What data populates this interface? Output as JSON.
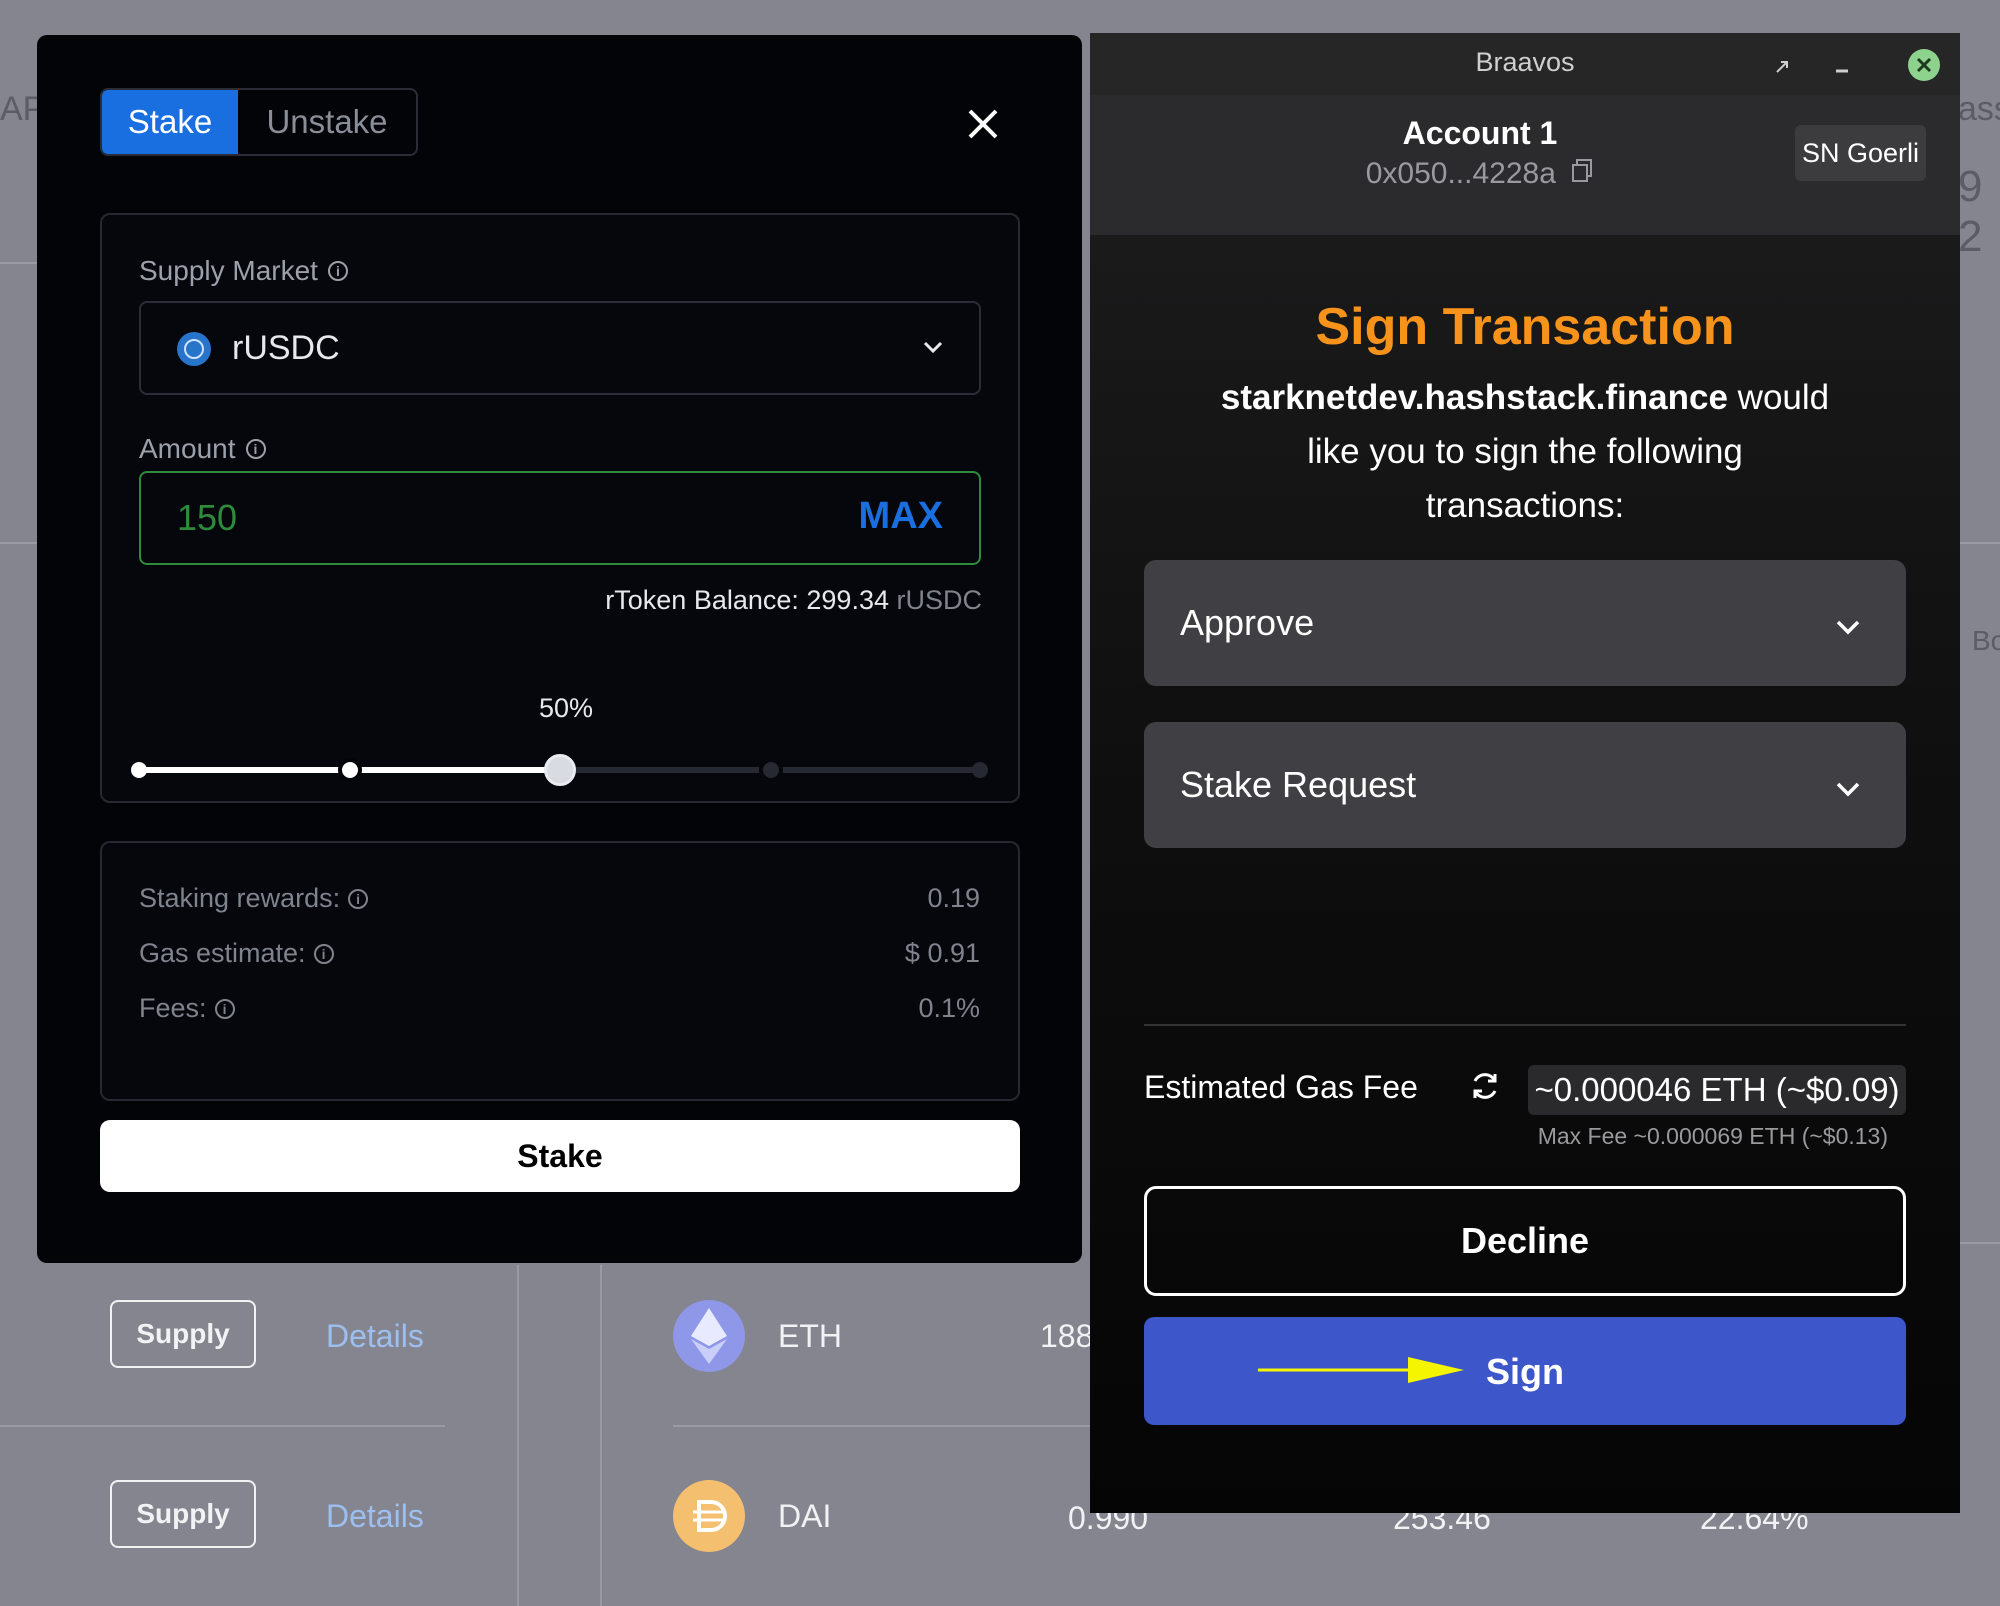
{
  "background": {
    "partial_texts": [
      "AP",
      "ass",
      "9 2",
      "Bo"
    ],
    "rows": [
      {
        "supply_label": "Supply",
        "details_label": "Details",
        "asset": "ETH",
        "price": "188"
      },
      {
        "supply_label": "Supply",
        "details_label": "Details",
        "asset": "DAI",
        "price": "0.990",
        "col2": "253.46",
        "col3": "22.64%"
      }
    ]
  },
  "stake_modal": {
    "tabs": [
      {
        "label": "Stake",
        "active": true
      },
      {
        "label": "Unstake",
        "active": false
      }
    ],
    "supply_market_label": "Supply Market",
    "market_selected": "rUSDC",
    "amount_label": "Amount",
    "amount_value": "150",
    "max_label": "MAX",
    "balance_label": "rToken Balance: 299.34",
    "balance_unit": "rUSDC",
    "slider_percent_label": "50%",
    "slider_value": 0.5,
    "details": {
      "staking_rewards_label": "Staking rewards:",
      "staking_rewards_value": "0.19",
      "gas_estimate_label": "Gas estimate:",
      "gas_estimate_value": "$ 0.91",
      "fees_label": "Fees:",
      "fees_value": "0.1%"
    },
    "stake_button": "Stake"
  },
  "braavos": {
    "window_title": "Braavos",
    "account_name": "Account 1",
    "account_address": "0x050...4228a",
    "network": "SN Goerli",
    "heading": "Sign Transaction",
    "dapp_domain": "starknetdev.hashstack.finance",
    "message_line1": "would",
    "message_line2": "like you to sign the following",
    "message_line3": "transactions:",
    "transactions": [
      "Approve",
      "Stake Request"
    ],
    "gas_fee_label": "Estimated Gas Fee",
    "gas_fee_value": "~0.000046 ETH (~$0.09)",
    "max_fee": "Max Fee ~0.000069 ETH (~$0.13)",
    "decline_label": "Decline",
    "sign_label": "Sign"
  },
  "colors": {
    "accent_orange": "#f7931a",
    "sign_blue": "#3d56c9",
    "stake_tab_blue": "#1a6fe0",
    "amount_green": "#2e8b3c",
    "annotation_arrow": "#f5f500"
  }
}
